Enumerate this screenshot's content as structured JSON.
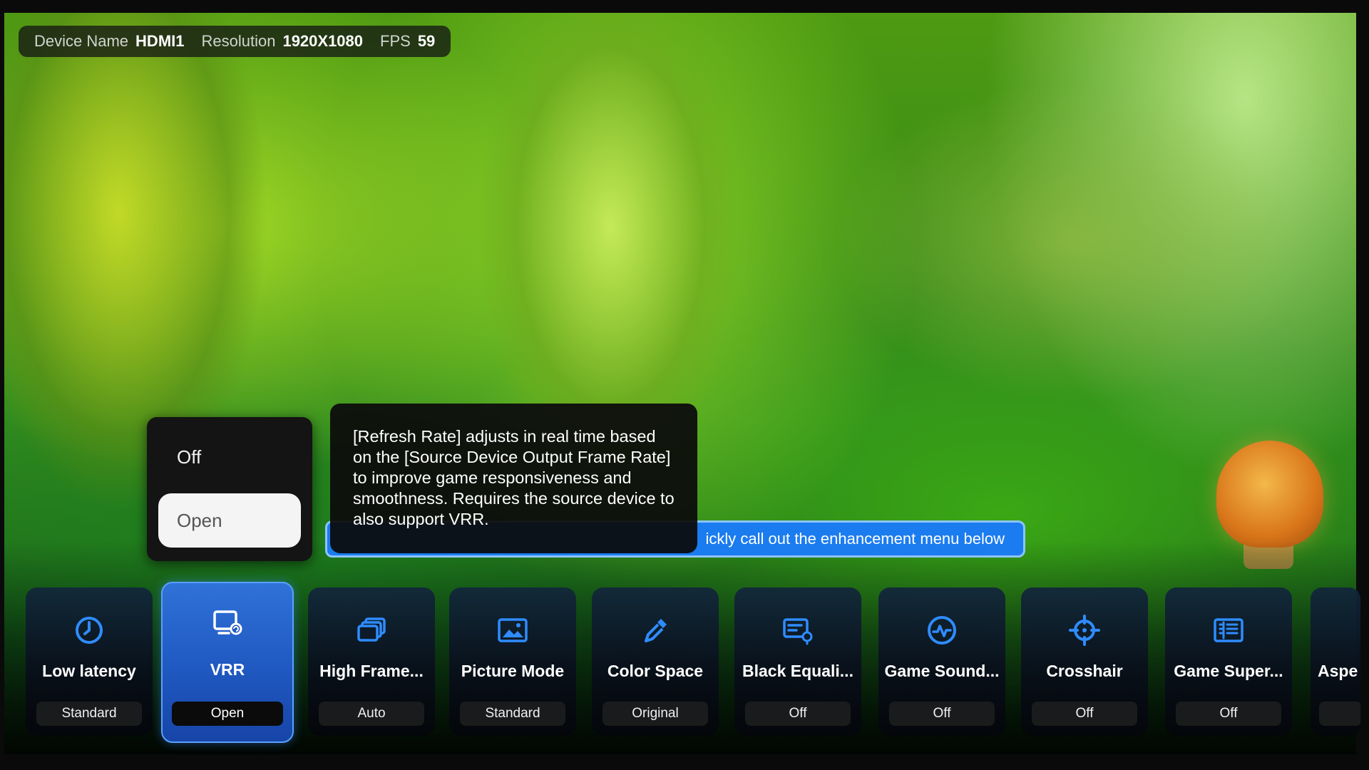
{
  "info_bar": {
    "device_name_label": "Device Name",
    "device_name_value": "HDMI1",
    "resolution_label": "Resolution",
    "resolution_value": "1920X1080",
    "fps_label": "FPS",
    "fps_value": "59"
  },
  "hint_banner": {
    "text": "ickly call out the enhancement menu below"
  },
  "option_popup": {
    "options": [
      "Off",
      "Open"
    ],
    "selected": "Open"
  },
  "tooltip": {
    "text": "[Refresh Rate] adjusts in real time based on the [Source Device Output Frame Rate] to improve game responsiveness and smoothness. Requires the source device to also support VRR."
  },
  "settings": [
    {
      "title": "Low latency",
      "value": "Standard",
      "icon": "clock-icon"
    },
    {
      "title": "VRR",
      "value": "Open",
      "icon": "vrr-display-icon",
      "active": true
    },
    {
      "title": "High Frame...",
      "value": "Auto",
      "icon": "stacked-frames-icon"
    },
    {
      "title": "Picture Mode",
      "value": "Standard",
      "icon": "picture-icon"
    },
    {
      "title": "Color Space",
      "value": "Original",
      "icon": "eyedropper-icon"
    },
    {
      "title": "Black Equali...",
      "value": "Off",
      "icon": "black-equalizer-icon"
    },
    {
      "title": "Game Sound...",
      "value": "Off",
      "icon": "sound-wave-icon"
    },
    {
      "title": "Crosshair",
      "value": "Off",
      "icon": "crosshair-icon"
    },
    {
      "title": "Game Super...",
      "value": "Off",
      "icon": "super-resolution-icon"
    },
    {
      "title": "Aspe",
      "value": "",
      "icon": "aspect-icon"
    }
  ],
  "colors": {
    "accent_blue": "#1b7cf0",
    "active_card": "#2f72d8",
    "icon_blue": "#2f8cff"
  }
}
